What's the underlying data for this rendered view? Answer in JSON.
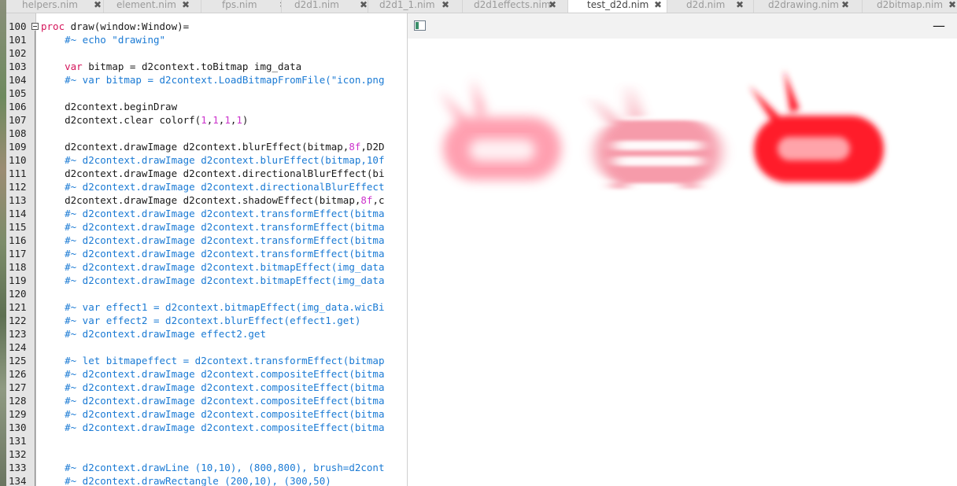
{
  "tabs": [
    {
      "label": "helpers.nim",
      "active": false
    },
    {
      "label": "element.nim",
      "active": false
    },
    {
      "label": "fps.nim",
      "active": false
    },
    {
      "label": "d2d1.nim",
      "active": false
    },
    {
      "label": "d2d1_1.nim",
      "active": false
    },
    {
      "label": "d2d1effects.nim",
      "active": false
    },
    {
      "label": "test_d2d.nim",
      "active": true
    },
    {
      "label": "d2d.nim",
      "active": false
    },
    {
      "label": "d2drawing.nim",
      "active": false
    },
    {
      "label": "d2bitmap.nim",
      "active": false
    }
  ],
  "tab_close_glyph": "✖",
  "editor": {
    "lines": [
      {
        "n": "100",
        "text": "proc draw(window:Window)=",
        "kind": "code"
      },
      {
        "n": "101",
        "text": "    #~ echo \"drawing\"",
        "kind": "comment"
      },
      {
        "n": "102",
        "text": "",
        "kind": "code"
      },
      {
        "n": "103",
        "text": "    var bitmap = d2context.toBitmap img_data",
        "kind": "code"
      },
      {
        "n": "104",
        "text": "    #~ var bitmap = d2context.LoadBitmapFromFile(\"icon.png",
        "kind": "comment"
      },
      {
        "n": "105",
        "text": "",
        "kind": "code"
      },
      {
        "n": "106",
        "text": "    d2context.beginDraw",
        "kind": "code"
      },
      {
        "n": "107",
        "text": "    d2context.clear colorf(1,1,1,1)",
        "kind": "code"
      },
      {
        "n": "108",
        "text": "",
        "kind": "code"
      },
      {
        "n": "109",
        "text": "    d2context.drawImage d2context.blurEffect(bitmap,8f,D2D",
        "kind": "code"
      },
      {
        "n": "110",
        "text": "    #~ d2context.drawImage d2context.blurEffect(bitmap,10f",
        "kind": "comment"
      },
      {
        "n": "111",
        "text": "    d2context.drawImage d2context.directionalBlurEffect(bi",
        "kind": "code"
      },
      {
        "n": "112",
        "text": "    #~ d2context.drawImage d2context.directionalBlurEffect",
        "kind": "comment"
      },
      {
        "n": "113",
        "text": "    d2context.drawImage d2context.shadowEffect(bitmap,8f,c",
        "kind": "code"
      },
      {
        "n": "114",
        "text": "    #~ d2context.drawImage d2context.transformEffect(bitma",
        "kind": "comment"
      },
      {
        "n": "115",
        "text": "    #~ d2context.drawImage d2context.transformEffect(bitma",
        "kind": "comment"
      },
      {
        "n": "116",
        "text": "    #~ d2context.drawImage d2context.transformEffect(bitma",
        "kind": "comment"
      },
      {
        "n": "117",
        "text": "    #~ d2context.drawImage d2context.transformEffect(bitma",
        "kind": "comment"
      },
      {
        "n": "118",
        "text": "    #~ d2context.drawImage d2context.bitmapEffect(img_data",
        "kind": "comment"
      },
      {
        "n": "119",
        "text": "    #~ d2context.drawImage d2context.bitmapEffect(img_data",
        "kind": "comment"
      },
      {
        "n": "120",
        "text": "",
        "kind": "code"
      },
      {
        "n": "121",
        "text": "    #~ var effect1 = d2context.bitmapEffect(img_data.wicBi",
        "kind": "comment"
      },
      {
        "n": "122",
        "text": "    #~ var effect2 = d2context.blurEffect(effect1.get)",
        "kind": "comment"
      },
      {
        "n": "123",
        "text": "    #~ d2context.drawImage effect2.get",
        "kind": "comment"
      },
      {
        "n": "124",
        "text": "",
        "kind": "code"
      },
      {
        "n": "125",
        "text": "    #~ let bitmapeffect = d2context.transformEffect(bitmap",
        "kind": "comment"
      },
      {
        "n": "126",
        "text": "    #~ d2context.drawImage d2context.compositeEffect(bitma",
        "kind": "comment"
      },
      {
        "n": "127",
        "text": "    #~ d2context.drawImage d2context.compositeEffect(bitma",
        "kind": "comment"
      },
      {
        "n": "128",
        "text": "    #~ d2context.drawImage d2context.compositeEffect(bitma",
        "kind": "comment"
      },
      {
        "n": "129",
        "text": "    #~ d2context.drawImage d2context.compositeEffect(bitma",
        "kind": "comment"
      },
      {
        "n": "130",
        "text": "    #~ d2context.drawImage d2context.compositeEffect(bitma",
        "kind": "comment"
      },
      {
        "n": "131",
        "text": "",
        "kind": "code"
      },
      {
        "n": "132",
        "text": "",
        "kind": "code"
      },
      {
        "n": "133",
        "text": "    #~ d2context.drawLine (10,10), (800,800), brush=d2cont",
        "kind": "comment"
      },
      {
        "n": "134",
        "text": "    #~ d2context.drawRectangle (200,10), (300,50)",
        "kind": "comment"
      }
    ]
  },
  "output_window": {
    "minimize_glyph": "—",
    "sprites": [
      {
        "name": "blurred-sprite",
        "color": "#ff8fa3"
      },
      {
        "name": "directional-blur-sprite",
        "color": "#f58a9c"
      },
      {
        "name": "shadow-sprite",
        "color": "#ff1a2a"
      }
    ]
  }
}
